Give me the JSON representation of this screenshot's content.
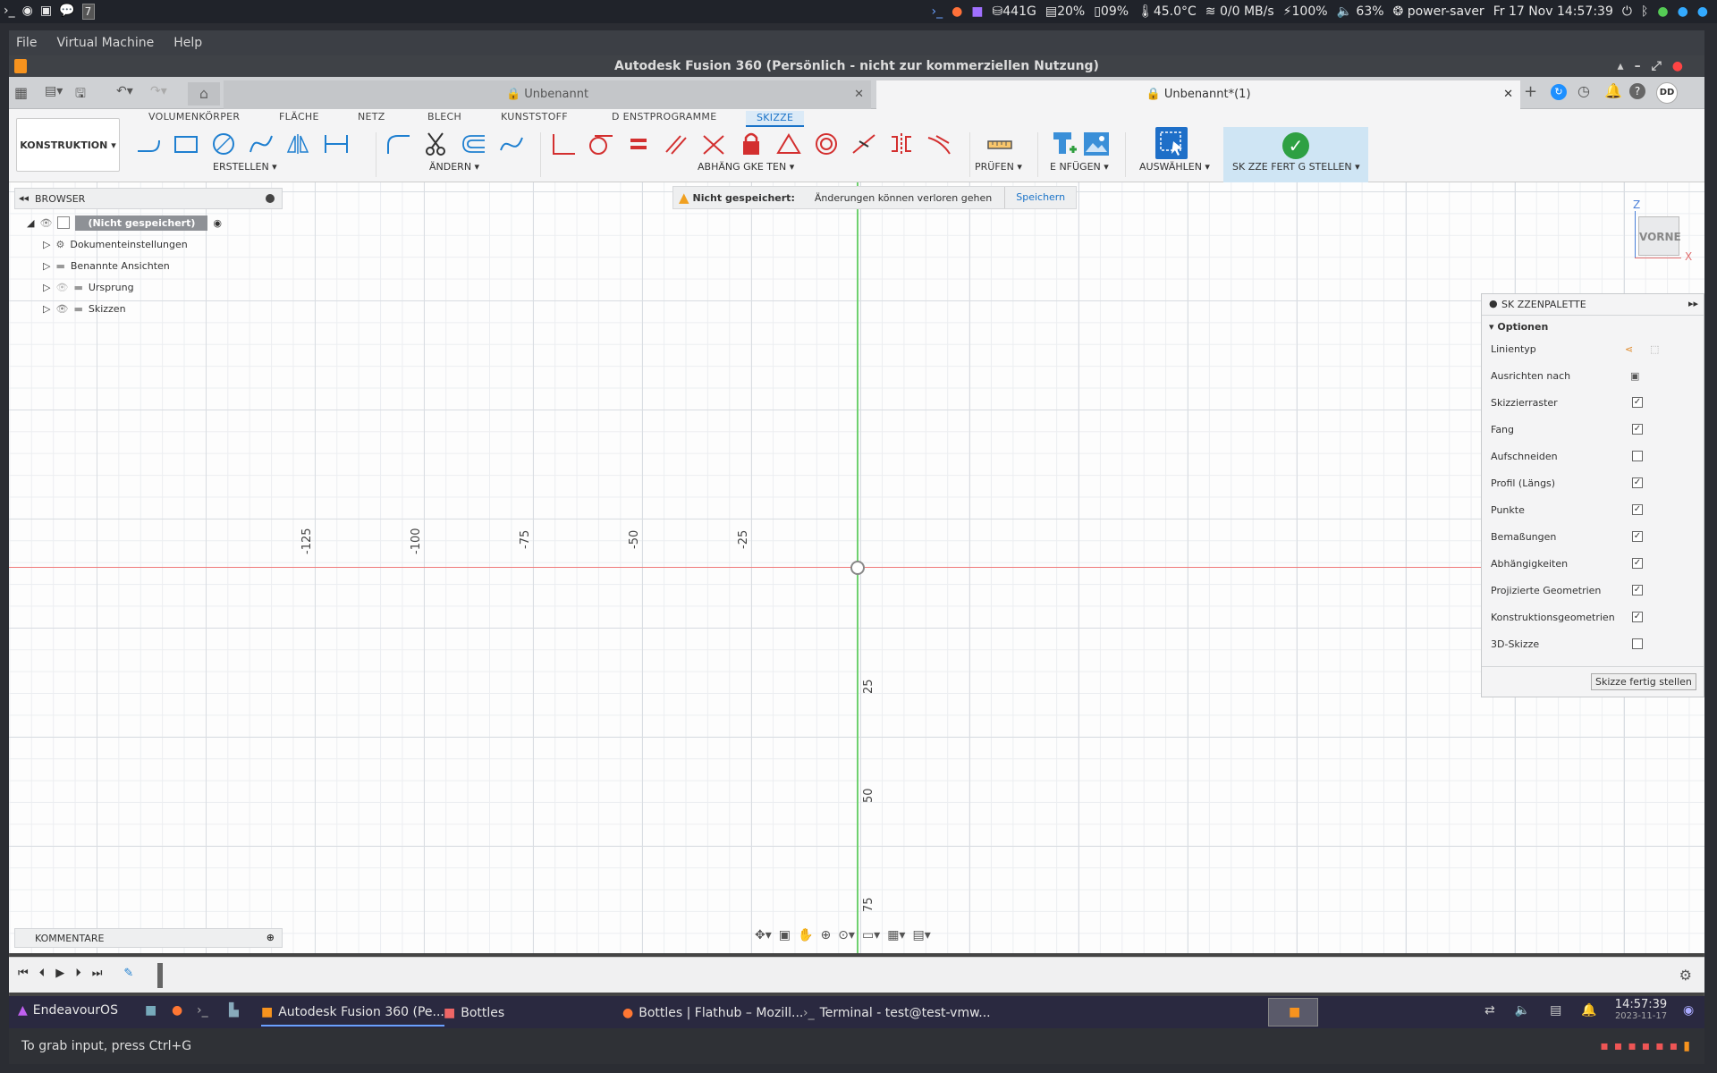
{
  "topbar": {
    "workspace": "7",
    "disk": "441G",
    "cpu": "20%",
    "mem": "09%",
    "temp": "45.0°C",
    "net": "0/0 MB/s",
    "power": "100%",
    "volume": "63%",
    "profile": "power-saver",
    "datetime": "Fr 17 Nov 14:57:39"
  },
  "vm_menu": [
    "File",
    "Virtual Machine",
    "Help"
  ],
  "app_title": "Autodesk Fusion 360 (Persönlich - nicht zur kommerziellen Nutzung)",
  "doc_tabs": [
    {
      "label": "Unbenannt"
    },
    {
      "label": "Unbenannt*(1)"
    }
  ],
  "user_initials": "DD",
  "ribbon": {
    "workspace": "KONSTRUKTION",
    "tabs": [
      "VOLUMENKÖRPER",
      "FLÄCHE",
      "NETZ",
      "BLECH",
      "KUNSTSTOFF",
      "D ENSTPROGRAMME",
      "SKIZZE"
    ],
    "groups": [
      "ERSTELLEN",
      "ÄNDERN",
      "ABHÄNG GKE TEN",
      "PRÜFEN",
      "E NFÜGEN",
      "AUSWÄHLEN",
      "SK ZZE FERT G STELLEN"
    ]
  },
  "notice": {
    "label": "Nicht gespeichert:",
    "text": "Änderungen können verloren gehen",
    "action": "Speichern"
  },
  "browser": {
    "title": "BROWSER",
    "root": "(Nicht gespeichert)",
    "items": [
      "Dokumenteinstellungen",
      "Benannte Ansichten",
      "Ursprung",
      "Skizzen"
    ]
  },
  "comments": "KOMMENTARE",
  "viewcube": {
    "face": "VORNE",
    "z": "Z",
    "x": "X"
  },
  "axis_labels": {
    "x": [
      "-125",
      "-100",
      "-75",
      "-50",
      "-25"
    ],
    "y": [
      "25",
      "50",
      "75"
    ]
  },
  "palette": {
    "title": "SK ZZENPALETTE",
    "section": "Optionen",
    "rows": [
      {
        "label": "Linientyp"
      },
      {
        "label": "Ausrichten nach"
      },
      {
        "label": "Skizzierraster",
        "checked": true
      },
      {
        "label": "Fang",
        "checked": true
      },
      {
        "label": "Aufschneiden",
        "checked": false
      },
      {
        "label": "Profil (Längs)",
        "checked": true
      },
      {
        "label": "Punkte",
        "checked": true
      },
      {
        "label": "Bemaßungen",
        "checked": true
      },
      {
        "label": "Abhängigkeiten",
        "checked": true
      },
      {
        "label": "Projizierte Geometrien",
        "checked": true
      },
      {
        "label": "Konstruktionsgeometrien",
        "checked": true
      },
      {
        "label": "3D-Skizze",
        "checked": false
      }
    ],
    "button": "Skizze fertig stellen"
  },
  "taskbar": {
    "start": "EndeavourOS",
    "items": [
      "Autodesk Fusion 360 (Pe...",
      "Bottles",
      "Bottles | Flathub – Mozill...",
      "Terminal - test@test-vmw..."
    ],
    "time": "14:57:39",
    "date": "2023-11-17"
  },
  "grab_hint": "To grab input, press Ctrl+G"
}
